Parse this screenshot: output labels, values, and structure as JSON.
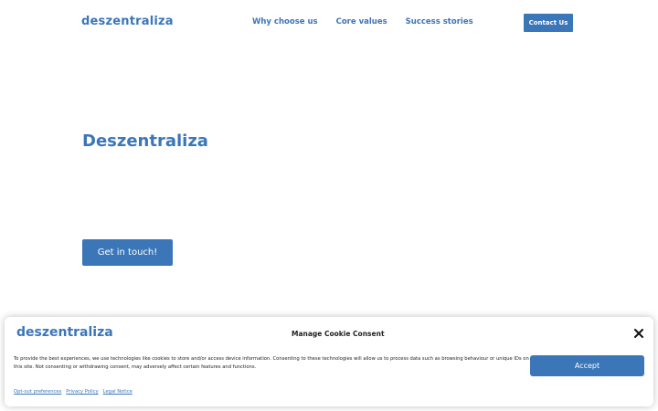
{
  "header": {
    "logo": "deszentraliza",
    "nav": [
      {
        "label": "Why choose us"
      },
      {
        "label": "Core values"
      },
      {
        "label": "Success stories"
      }
    ],
    "contact_label": "Contact Us"
  },
  "hero": {
    "title": "Deszentraliza",
    "cta_label": "Get in touch!"
  },
  "cookie_banner": {
    "logo": "deszentraliza",
    "title": "Manage Cookie Consent",
    "text": "To provide the best experiences, we use technologies like cookies to store and/or access device information. Consenting to these technologies will allow us to process data such as browsing behaviour or unique IDs on this site. Not consenting or withdrawing consent, may adversely affect certain features and functions.",
    "accept_label": "Accept",
    "links": [
      {
        "label": "Opt-out preferences"
      },
      {
        "label": "Privacy Policy"
      },
      {
        "label": "Legal Notice"
      }
    ],
    "close_icon": "close-icon"
  },
  "colors": {
    "brand": "#3b76b8",
    "text": "#222222",
    "background": "#ffffff"
  }
}
